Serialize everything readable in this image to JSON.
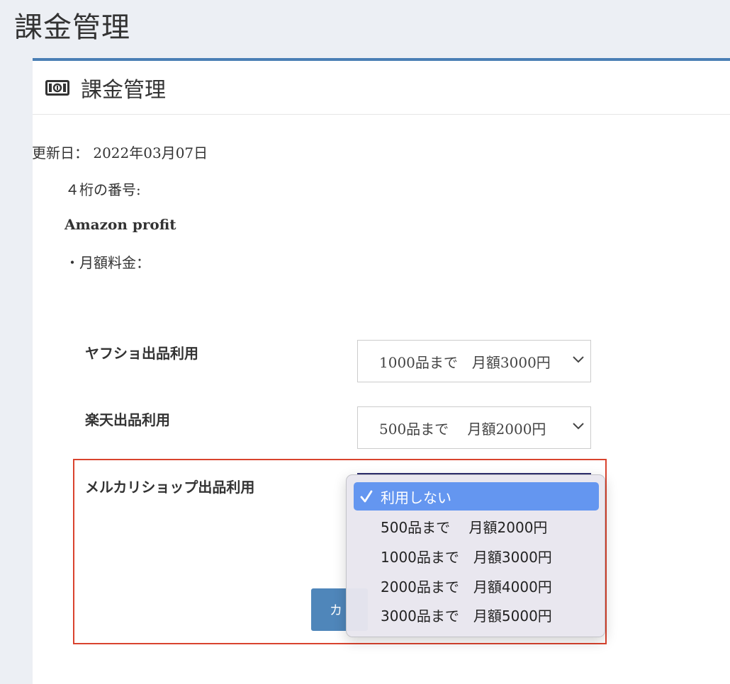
{
  "page": {
    "title": "課金管理"
  },
  "panel": {
    "icon": "money-bill-icon",
    "title": "課金管理",
    "update_date": "更新日： 2022年03月07日",
    "card_digits": "４桁の番号:",
    "plan_name": "Amazon profit",
    "monthly_fee": "・月額料金："
  },
  "form": {
    "rows": [
      {
        "label": "ヤフショ出品利用",
        "value": "1000品まで　月額3000円"
      },
      {
        "label": "楽天出品利用",
        "value": "500品まで　 月額2000円"
      },
      {
        "label": "メルカリショップ出品利用",
        "value": "利用しない"
      }
    ],
    "submit_label": "カ"
  },
  "dropdown": {
    "options": [
      {
        "label": "利用しない",
        "selected": true
      },
      {
        "label": "500品まで　 月額2000円",
        "selected": false
      },
      {
        "label": "1000品まで　月額3000円",
        "selected": false
      },
      {
        "label": "2000品まで　月額4000円",
        "selected": false
      },
      {
        "label": "3000品まで　月額5000円",
        "selected": false
      }
    ]
  },
  "colors": {
    "accent": "#4a7fb5",
    "highlight": "#d9432e",
    "selected": "#6496f0"
  }
}
